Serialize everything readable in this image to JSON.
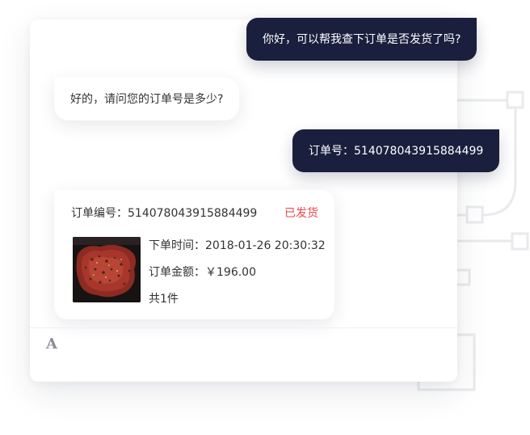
{
  "messages": {
    "user_1": "你好，可以帮我查下订单是否发货了吗?",
    "agent_1": "好的，请问您的订单号是多少?",
    "user_2": "订单号：514078043915884499"
  },
  "order": {
    "number_text": "订单编号：514078043915884499",
    "status": "已发货",
    "order_time": "下单时间：2018-01-26  20:30:32",
    "amount": "订单金额：￥196.00",
    "quantity": "共1件",
    "image_icon": "steak-photo"
  },
  "input_bar": {
    "font_icon": "A"
  },
  "colors": {
    "user_bubble": "#1a1f3d",
    "status_red": "#e9474a"
  }
}
